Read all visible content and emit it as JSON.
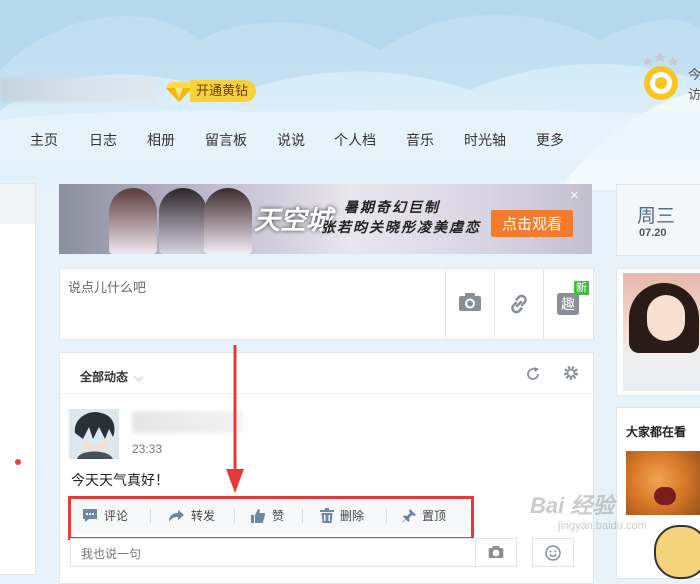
{
  "header": {
    "vip_label": "开通黄钻",
    "right_partial_1": "今",
    "right_partial_2": "访"
  },
  "nav": {
    "items": [
      "主页",
      "日志",
      "相册",
      "留言板",
      "说说",
      "个人档",
      "音乐",
      "时光轴",
      "更多"
    ]
  },
  "banner": {
    "logo": "天空城",
    "line1": "暑期奇幻巨制",
    "line2": "张若昀关晓彤凌美虐恋",
    "cta": "点击观看",
    "close": "×"
  },
  "composer": {
    "placeholder": "说点儿什么吧",
    "badge": "新",
    "fun_label": "趣"
  },
  "feed": {
    "filter": "全部动态",
    "post": {
      "time": "23:33",
      "text": "今天天气真好！"
    },
    "actions": [
      "评论",
      "转发",
      "赞",
      "删除",
      "置顶"
    ],
    "comment_placeholder": "我也说一句"
  },
  "sidebar": {
    "day": "周三",
    "date": "07.20",
    "everyone_title": "大家都在看"
  },
  "watermark": {
    "main": "Bai 经验",
    "sub": "jingyan.baidu.com"
  },
  "colors": {
    "accent_red": "#e53a3a",
    "vip_yellow": "#f8d23a",
    "cta_orange": "#f27b2d"
  }
}
